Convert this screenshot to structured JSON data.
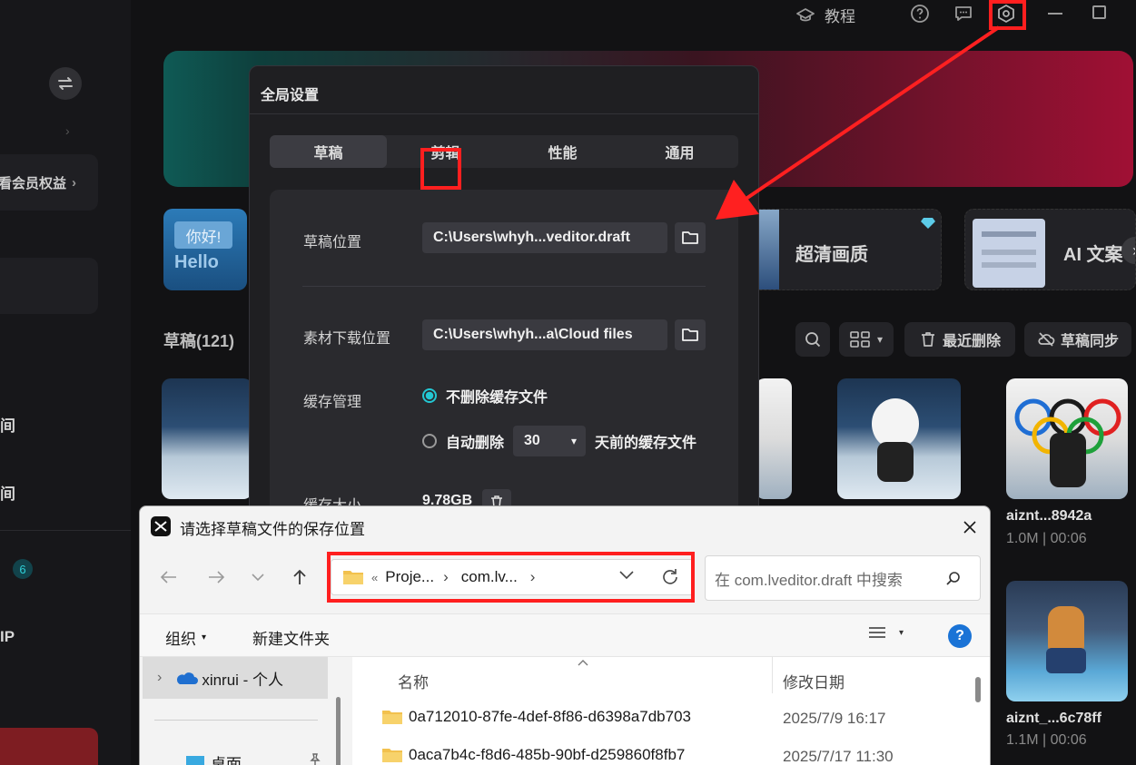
{
  "topbar": {
    "tutorial_label": "教程"
  },
  "sidebar": {
    "member_label": "看会员权益",
    "item_a": "间",
    "item_b": "间",
    "badge_count": "6",
    "item_c": "IP"
  },
  "cards": {
    "hello_text_top": "你好!",
    "hello_text_bottom": "Hello",
    "hd_label": "超清画质",
    "ai_label": "AI 文案"
  },
  "drafts": {
    "header": "草稿(121)",
    "recent_delete": "最近删除",
    "sync": "草稿同步",
    "items": [
      {
        "name": "aiznt...8942a",
        "meta": "1.0M | 00:06"
      },
      {
        "name": "aiznt_...6c78ff",
        "meta": "1.1M | 00:06"
      }
    ]
  },
  "settings": {
    "title": "全局设置",
    "tabs": [
      "草稿",
      "剪辑",
      "性能",
      "通用"
    ],
    "draft_location_label": "草稿位置",
    "draft_location_path": "C:\\Users\\whyh...veditor.draft",
    "material_location_label": "素材下载位置",
    "material_location_path": "C:\\Users\\whyh...a\\Cloud files",
    "cache_label": "缓存管理",
    "cache_opt_keep": "不删除缓存文件",
    "cache_opt_auto": "自动删除",
    "cache_days": "30",
    "cache_days_suffix": "天前的缓存文件",
    "cache_size_label": "缓存大小",
    "cache_size_value": "9.78GB"
  },
  "file_dialog": {
    "title": "请选择草稿文件的保存位置",
    "breadcrumb_prefix": "«",
    "breadcrumb": [
      "Proje...",
      "com.lv..."
    ],
    "search_placeholder": "在 com.lveditor.draft 中搜索",
    "organize": "组织",
    "new_folder": "新建文件夹",
    "nav_onedrive": "xinrui - 个人",
    "nav_desktop": "桌面",
    "columns": {
      "name": "名称",
      "modified": "修改日期"
    },
    "files": [
      {
        "name": "0a712010-87fe-4def-8f86-d6398a7db703",
        "modified": "2025/7/9 16:17"
      },
      {
        "name": "0aca7b4c-f8d6-485b-90bf-d259860f8fb7",
        "modified": "2025/7/17 11:30"
      }
    ]
  }
}
